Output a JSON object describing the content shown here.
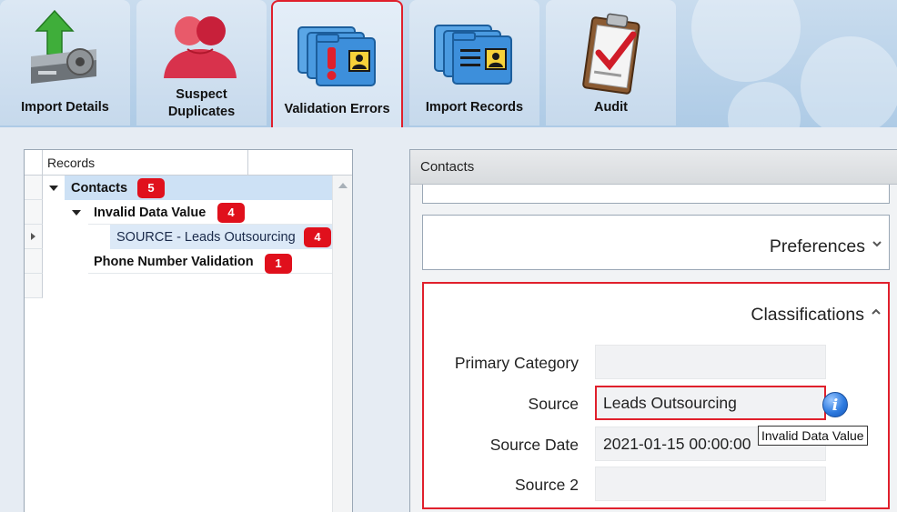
{
  "ribbon": {
    "tabs": [
      {
        "label": "Import Details",
        "icon": "disk-import-icon"
      },
      {
        "label": "Suspect\nDuplicates",
        "icon": "duplicate-people-icon"
      },
      {
        "label": "Validation Errors",
        "icon": "validation-folders-icon",
        "active": true
      },
      {
        "label": "Import Records",
        "icon": "record-folders-icon"
      },
      {
        "label": "Audit",
        "icon": "clipboard-check-icon"
      }
    ]
  },
  "records": {
    "header": "Records",
    "rows": [
      {
        "label": "Contacts",
        "count": "5"
      },
      {
        "label": "Invalid Data Value",
        "count": "4"
      },
      {
        "label": "SOURCE - Leads Outsourcing",
        "count": "4"
      },
      {
        "label": "Phone Number Validation",
        "count": "1"
      }
    ]
  },
  "contacts": {
    "header": "Contacts",
    "preferences_title": "Preferences",
    "classifications_title": "Classifications",
    "fields": [
      {
        "label": "Primary Category",
        "value": ""
      },
      {
        "label": "Source",
        "value": "Leads Outsourcing"
      },
      {
        "label": "Source Date",
        "value": "2021-01-15 00:00:00"
      },
      {
        "label": "Source 2",
        "value": ""
      }
    ],
    "info_glyph": "i",
    "tooltip": "Invalid Data Value"
  },
  "colors": {
    "error": "#e0202c",
    "badge": "#e0101c",
    "selection": "#cde1f5"
  }
}
